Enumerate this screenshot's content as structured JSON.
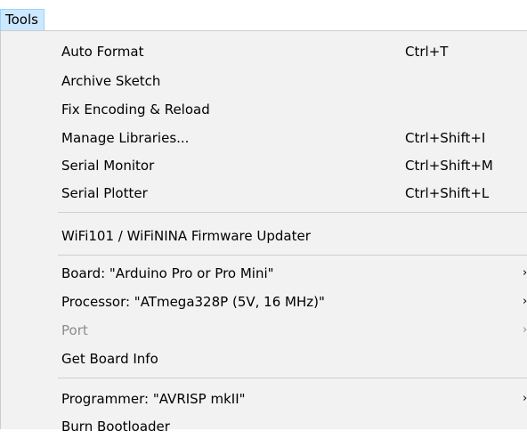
{
  "menubar": {
    "tools_label": "Tools"
  },
  "menu": {
    "items": [
      {
        "label": "Auto Format",
        "shortcut": "Ctrl+T"
      },
      {
        "label": "Archive Sketch",
        "shortcut": ""
      },
      {
        "label": "Fix Encoding & Reload",
        "shortcut": ""
      },
      {
        "label": "Manage Libraries...",
        "shortcut": "Ctrl+Shift+I"
      },
      {
        "label": "Serial Monitor",
        "shortcut": "Ctrl+Shift+M"
      },
      {
        "label": "Serial Plotter",
        "shortcut": "Ctrl+Shift+L"
      },
      {
        "label": "WiFi101 / WiFiNINA Firmware Updater",
        "shortcut": ""
      },
      {
        "label": "Board: \"Arduino Pro or Pro Mini\"",
        "submenu": true
      },
      {
        "label": "Processor: \"ATmega328P (5V, 16 MHz)\"",
        "submenu": true
      },
      {
        "label": "Port",
        "submenu": true,
        "disabled": true
      },
      {
        "label": "Get Board Info",
        "shortcut": ""
      },
      {
        "label": "Programmer: \"AVRISP mkII\"",
        "submenu": true
      },
      {
        "label": "Burn Bootloader",
        "shortcut": ""
      }
    ],
    "submenu_glyph": "›"
  },
  "colors": {
    "menubar_highlight": "#cce8ff",
    "menu_background": "#f2f2f2",
    "disabled_text": "#8c8c8c"
  }
}
